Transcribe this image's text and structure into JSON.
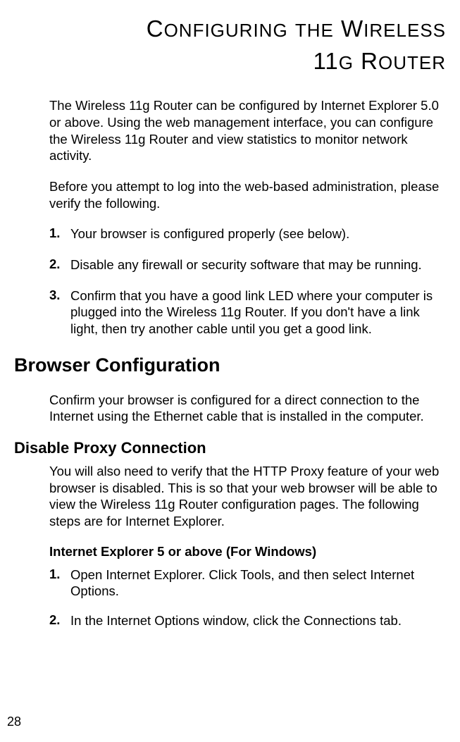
{
  "title_line1_parts": [
    "C",
    "ONFIGURING",
    " ",
    "THE",
    " W",
    "IRELESS"
  ],
  "title_line2_parts": [
    "11",
    "G",
    " R",
    "OUTER"
  ],
  "intro_p1": "The Wireless 11g Router can be configured by Internet Explorer 5.0 or above. Using the web management interface, you can configure the Wireless 11g Router and view statistics to monitor network activity.",
  "intro_p2": "Before you attempt to log into the web-based administration, please verify the following.",
  "list1": [
    "Your browser is configured properly (see below).",
    "Disable any firewall or security software that may be running.",
    "Confirm that you have a good link LED where your computer is plugged into the Wireless 11g Router. If you don't have a link light, then try another cable until you get a good link."
  ],
  "section_heading": "Browser Configuration",
  "section_p1": "Confirm your browser is configured for a direct connection to the Internet using the Ethernet cable that is installed in the computer.",
  "subsection_heading": "Disable Proxy Connection",
  "subsection_p1": "You will also need to verify that the HTTP Proxy feature of your web browser is disabled. This is so that your web browser will be able to view the Wireless 11g Router configuration pages. The following steps are for Internet Explorer.",
  "inline_heading": "Internet Explorer 5 or above (For Windows)",
  "list2": [
    "Open Internet Explorer. Click Tools, and then select Internet Options.",
    "In the Internet Options window, click the Connections tab."
  ],
  "page_number": "28"
}
